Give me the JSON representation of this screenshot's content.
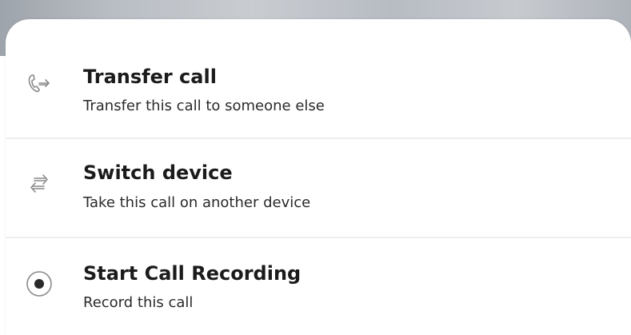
{
  "menu": {
    "items": [
      {
        "title": "Transfer call",
        "subtitle": "Transfer this call to someone else",
        "icon": "transfer-call-icon"
      },
      {
        "title": "Switch device",
        "subtitle": "Take this call on another device",
        "icon": "switch-device-icon"
      },
      {
        "title": "Start Call Recording",
        "subtitle": "Record this call",
        "icon": "record-icon"
      }
    ]
  },
  "colors": {
    "text_primary": "#1b1b1b",
    "icon": "#8a8a8a",
    "divider": "#eeeeee"
  }
}
